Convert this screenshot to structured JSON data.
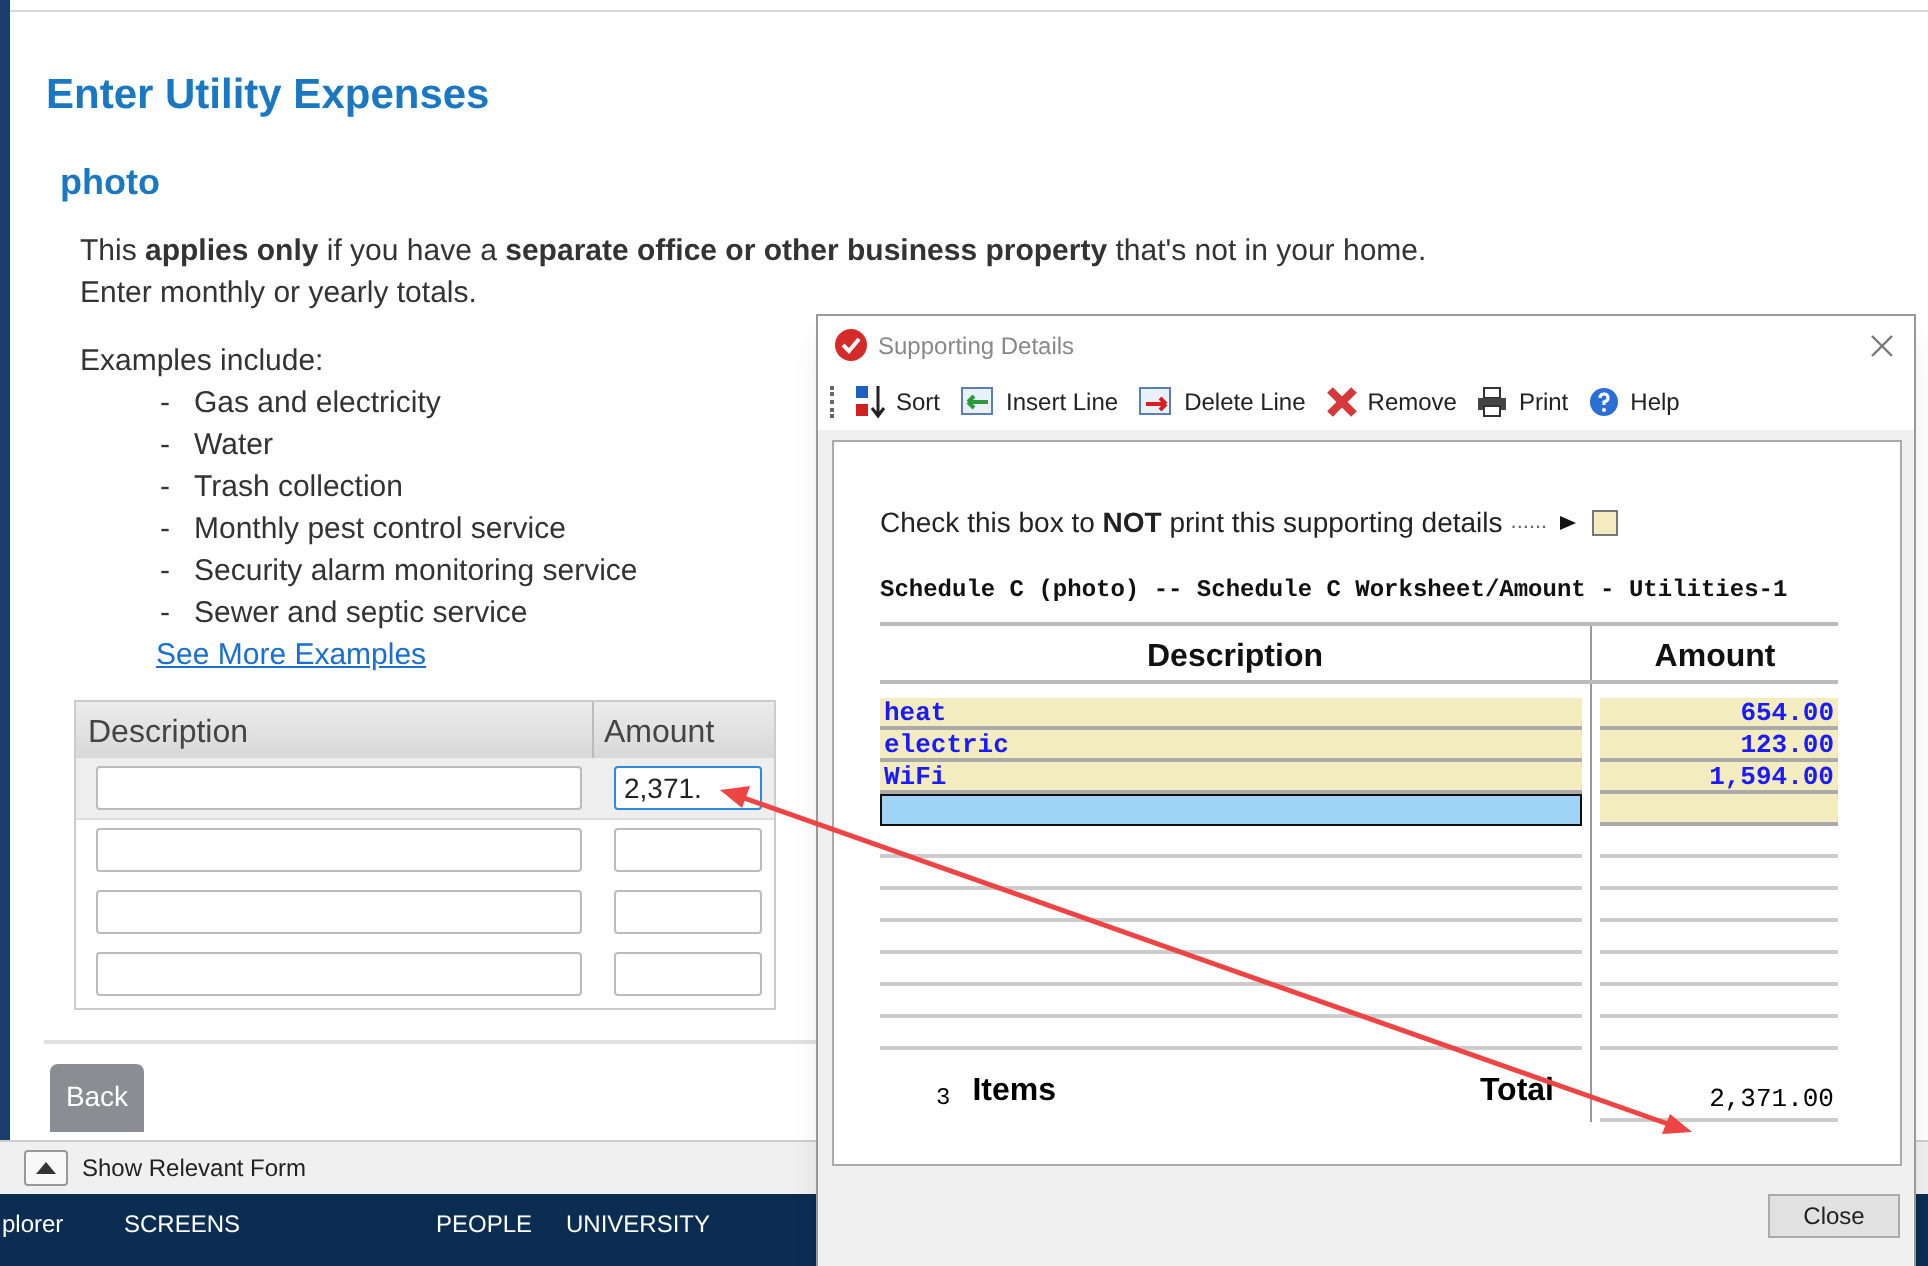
{
  "page": {
    "title": "Enter Utility Expenses",
    "subtitle": "photo",
    "intro": "This **applies only** if you have a **separate office or other business property** that's not in your home.",
    "intro_2": "Enter monthly or yearly totals.",
    "examples_heading": "Examples include:",
    "examples": [
      "Gas and electricity",
      "Water",
      "Trash collection",
      "Monthly pest control service",
      "Security alarm monitoring service",
      "Sewer and septic service"
    ],
    "bullet": "-",
    "more_link": "See More Examples"
  },
  "expense_table": {
    "columns": [
      "Description",
      "Amount"
    ],
    "rows": [
      {
        "amount": "2,371.",
        "selected": true
      },
      {
        "selected": false
      },
      {
        "selected": false
      },
      {
        "selected": false
      }
    ]
  },
  "back_button": "Back",
  "form_bar": {
    "label": "Show Relevant Form"
  },
  "taskbar": {
    "items": [
      "plorer",
      "SCREENS",
      "PEOPLE",
      "UNIVERSITY"
    ]
  },
  "dialog": {
    "title": "Supporting Details",
    "toolbar": [
      {
        "kind": "sort",
        "label": "Sort"
      },
      {
        "kind": "insert",
        "label": "Insert Line"
      },
      {
        "kind": "delete",
        "label": "Delete Line"
      },
      {
        "kind": "remove",
        "label": "Remove"
      },
      {
        "kind": "print",
        "label": "Print"
      },
      {
        "kind": "help",
        "label": "Help"
      }
    ],
    "notice": "Check this box to **NOT** print this supporting details",
    "leader": "......",
    "no_print_checked": false,
    "heading": "Schedule C (photo) -- Schedule C Worksheet/Amount - Utilities-1",
    "columns": [
      "Description",
      "Amount"
    ],
    "rows": [
      {
        "description": "heat",
        "amount": "654.00",
        "selected": false
      },
      {
        "description": "electric",
        "amount": "123.00",
        "selected": false
      },
      {
        "description": "WiFi",
        "amount": "1,594.00",
        "selected": false
      },
      {
        "selected": true
      }
    ],
    "item_count": "3",
    "items_label": "Items",
    "total_label": "Total",
    "total": "2,371.00",
    "close_button": "Close"
  }
}
